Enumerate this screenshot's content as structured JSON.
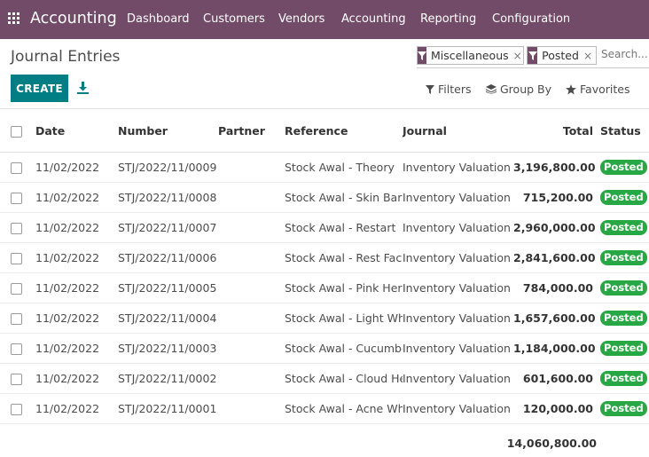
{
  "topbar": {
    "app_title": "Accounting",
    "menu": [
      "Dashboard",
      "Customers",
      "Vendors",
      "Accounting",
      "Reporting",
      "Configuration"
    ]
  },
  "control_panel": {
    "title": "Journal Entries",
    "create_label": "CREATE",
    "facets": [
      "Miscellaneous",
      "Posted"
    ],
    "facet_close": "×",
    "search_placeholder": "Search...",
    "filters_label": "Filters",
    "group_by_label": "Group By",
    "favorites_label": "Favorites"
  },
  "table": {
    "columns": {
      "date": "Date",
      "number": "Number",
      "partner": "Partner",
      "reference": "Reference",
      "journal": "Journal",
      "total": "Total",
      "status": "Status"
    },
    "rows": [
      {
        "date": "11/02/2022",
        "number": "STJ/2022/11/0009",
        "partner": "",
        "reference": "Stock Awal - Theory",
        "journal": "Inventory Valuation",
        "total": "3,196,800.00",
        "status": "Posted"
      },
      {
        "date": "11/02/2022",
        "number": "STJ/2022/11/0008",
        "partner": "",
        "reference": "Stock Awal - Skin Barrier",
        "journal": "Inventory Valuation",
        "total": "715,200.00",
        "status": "Posted"
      },
      {
        "date": "11/02/2022",
        "number": "STJ/2022/11/0007",
        "partner": "",
        "reference": "Stock Awal - Restart",
        "journal": "Inventory Valuation",
        "total": "2,960,000.00",
        "status": "Posted"
      },
      {
        "date": "11/02/2022",
        "number": "STJ/2022/11/0006",
        "partner": "",
        "reference": "Stock Awal - Rest Face",
        "journal": "Inventory Valuation",
        "total": "2,841,600.00",
        "status": "Posted"
      },
      {
        "date": "11/02/2022",
        "number": "STJ/2022/11/0005",
        "partner": "",
        "reference": "Stock Awal - Pink Hero",
        "journal": "Inventory Valuation",
        "total": "784,000.00",
        "status": "Posted"
      },
      {
        "date": "11/02/2022",
        "number": "STJ/2022/11/0004",
        "partner": "",
        "reference": "Stock Awal - Light White",
        "journal": "Inventory Valuation",
        "total": "1,657,600.00",
        "status": "Posted"
      },
      {
        "date": "11/02/2022",
        "number": "STJ/2022/11/0003",
        "partner": "",
        "reference": "Stock Awal - Cucumber",
        "journal": "Inventory Valuation",
        "total": "1,184,000.00",
        "status": "Posted"
      },
      {
        "date": "11/02/2022",
        "number": "STJ/2022/11/0002",
        "partner": "",
        "reference": "Stock Awal - Cloud Hero",
        "journal": "Inventory Valuation",
        "total": "601,600.00",
        "status": "Posted"
      },
      {
        "date": "11/02/2022",
        "number": "STJ/2022/11/0001",
        "partner": "",
        "reference": "Stock Awal - Acne White",
        "journal": "Inventory Valuation",
        "total": "120,000.00",
        "status": "Posted"
      }
    ],
    "grand_total": "14,060,800.00"
  },
  "colors": {
    "brand": "#714b67",
    "create_button": "#017e84",
    "status_posted": "#28a745"
  },
  "icons": [
    "apps-grid-icon",
    "filter-icon",
    "download-icon",
    "layers-icon",
    "star-icon"
  ]
}
